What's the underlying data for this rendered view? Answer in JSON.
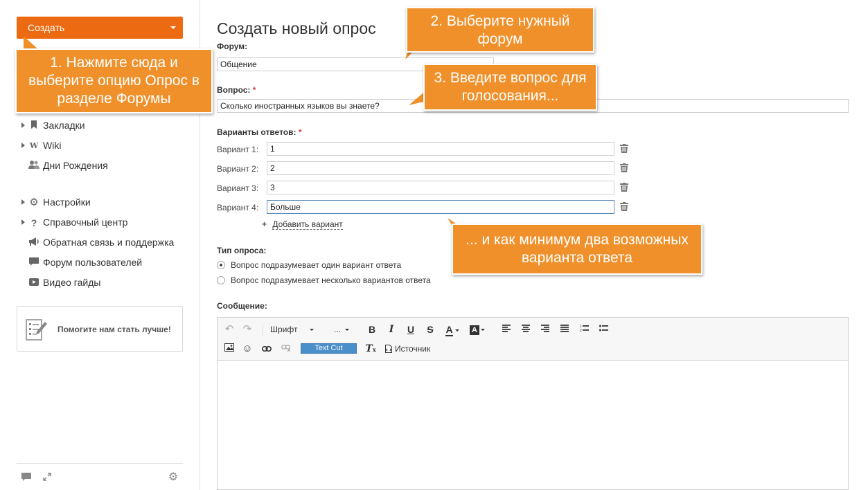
{
  "sidebar": {
    "create_label": "Создать",
    "items": [
      {
        "label": "Закладки",
        "icon": "bookmark-icon",
        "arrow": true
      },
      {
        "label": "Wiki",
        "icon": "wiki-icon",
        "arrow": true
      },
      {
        "label": "Дни Рождения",
        "icon": "users-icon",
        "arrow": false
      },
      {
        "label": "Настройки",
        "icon": "gear-icon",
        "arrow": true
      },
      {
        "label": "Справочный центр",
        "icon": "question-icon",
        "arrow": true
      },
      {
        "label": "Обратная связь и поддержка",
        "icon": "megaphone-icon",
        "arrow": false
      },
      {
        "label": "Форум пользователей",
        "icon": "chat-icon",
        "arrow": false
      },
      {
        "label": "Видео гайды",
        "icon": "video-icon",
        "arrow": false
      }
    ],
    "help_text": "Помогите нам стать лучше!"
  },
  "main": {
    "title": "Создать новый опрос",
    "forum_label": "Форум:",
    "forum_value": "Общение",
    "question_label": "Вопрос:",
    "question_value": "Сколько иностранных языков вы знаете?",
    "required_mark": "*",
    "answers_label": "Варианты ответов:",
    "options": [
      {
        "label": "Вариант 1:",
        "value": "1"
      },
      {
        "label": "Вариант 2:",
        "value": "2"
      },
      {
        "label": "Вариант 3:",
        "value": "3"
      },
      {
        "label": "Вариант 4:",
        "value": "Больше"
      }
    ],
    "add_variant": "Добавить вариант",
    "poll_type_label": "Тип опроса:",
    "poll_types": [
      {
        "label": "Вопрос подразумевает один вариант ответа",
        "selected": true
      },
      {
        "label": "Вопрос подразумевает несколько вариантов ответа",
        "selected": false
      }
    ],
    "message_label": "Сообщение:"
  },
  "editor": {
    "font_label": "Шрифт",
    "size_label": "...",
    "text_cut": "Text Cut",
    "source_label": "Источник"
  },
  "callouts": {
    "c1": "1. Нажмите сюда и выберите опцию Опрос в разделе Форумы",
    "c2": "2. Выберите нужный форум",
    "c3": "3. Введите вопрос для голосования...",
    "c4": "... и как минимум два возможных варианта ответа"
  },
  "colors": {
    "accent": "#ec6b12",
    "callout": "#f0902a",
    "text_cut": "#4a8fc9"
  }
}
